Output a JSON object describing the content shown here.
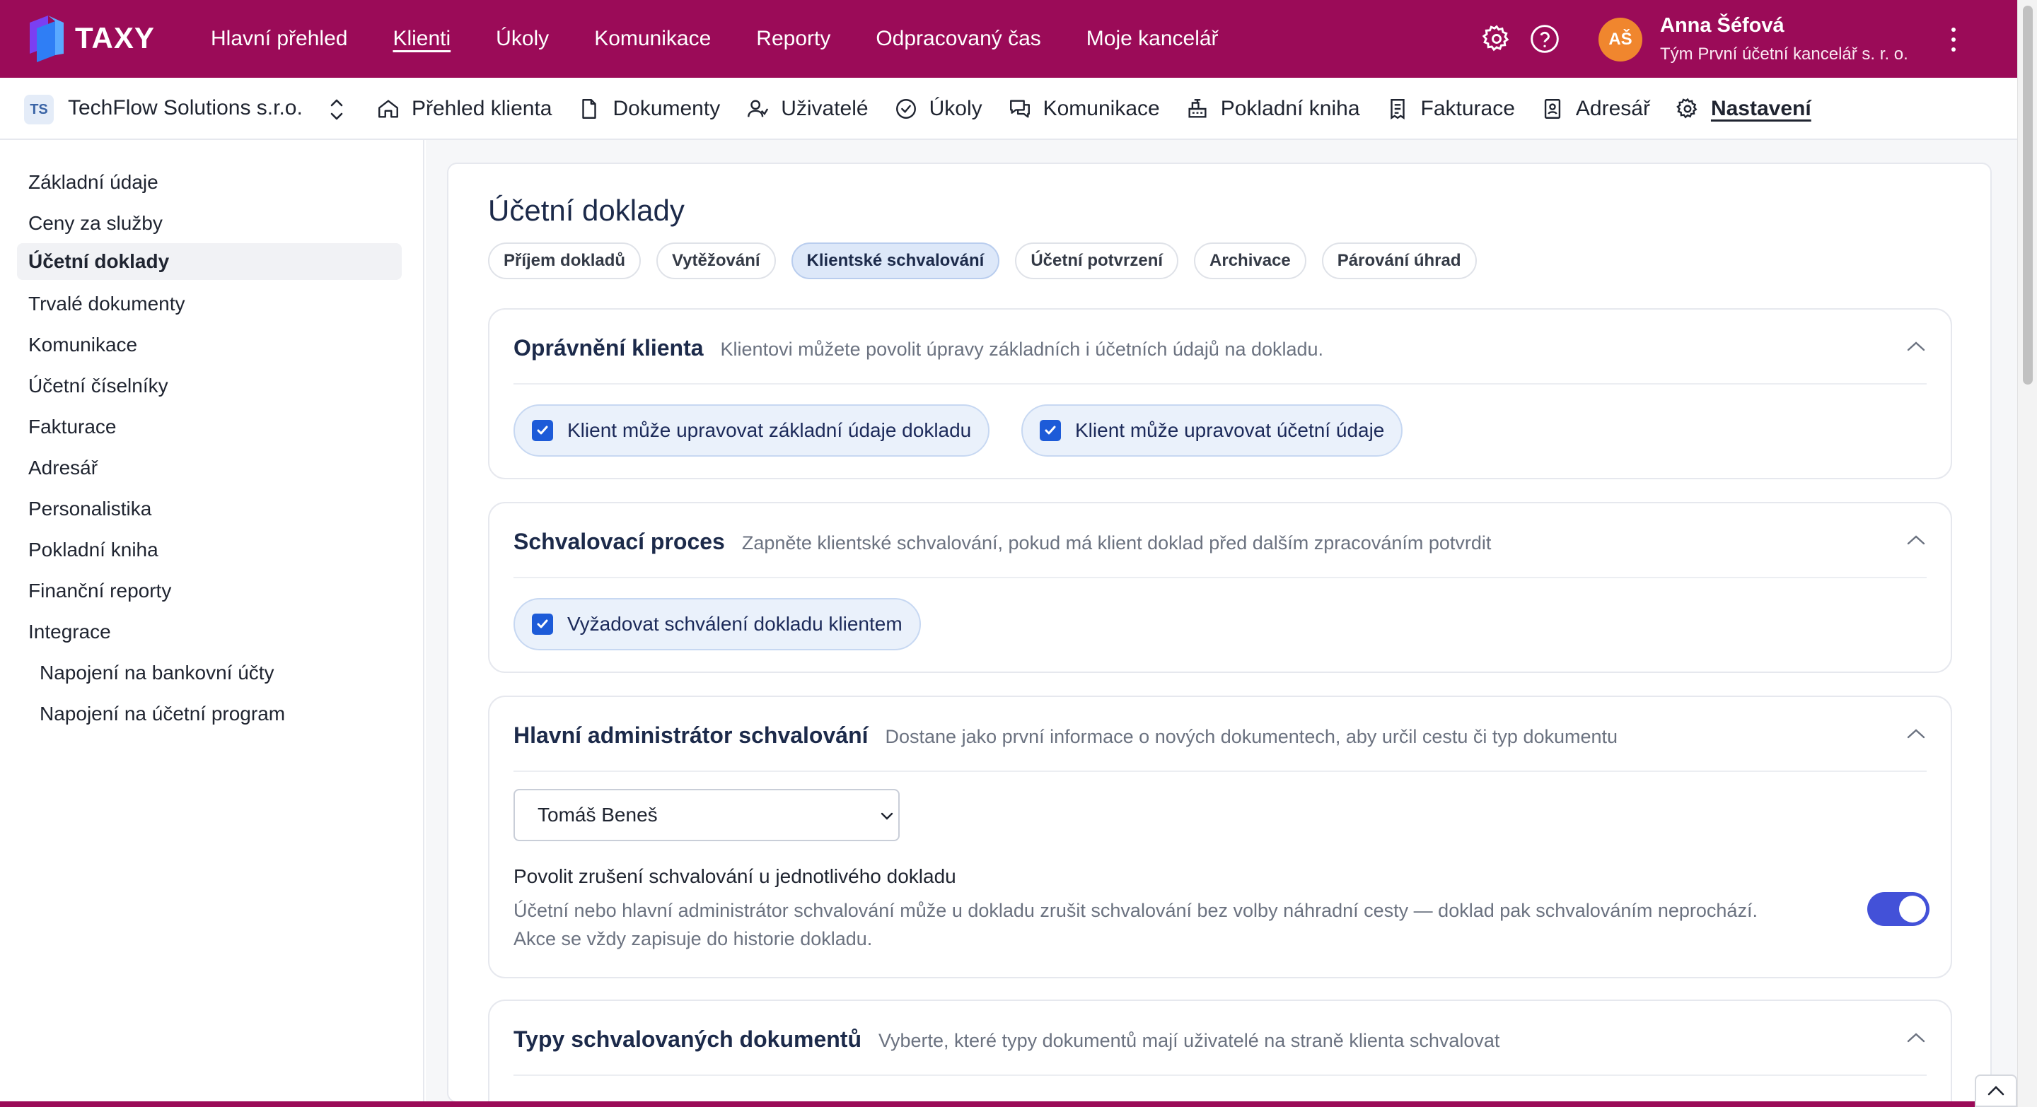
{
  "app": {
    "brand": "TAXY"
  },
  "top_nav": {
    "items": [
      "Hlavní přehled",
      "Klienti",
      "Úkoly",
      "Komunikace",
      "Reporty",
      "Odpracovaný čas",
      "Moje kancelář"
    ],
    "active": "Klienti"
  },
  "user": {
    "initials": "AŠ",
    "name": "Anna Šéfová",
    "team": "Tým První účetní kancelář s. r. o."
  },
  "client": {
    "badge": "TS",
    "name": "TechFlow Solutions s.r.o."
  },
  "sub_nav": {
    "items": [
      {
        "label": "Přehled klienta",
        "icon": "home-icon"
      },
      {
        "label": "Dokumenty",
        "icon": "document-icon"
      },
      {
        "label": "Uživatelé",
        "icon": "users-icon"
      },
      {
        "label": "Úkoly",
        "icon": "check-circle-icon"
      },
      {
        "label": "Komunikace",
        "icon": "chat-icon"
      },
      {
        "label": "Pokladní kniha",
        "icon": "cash-register-icon"
      },
      {
        "label": "Fakturace",
        "icon": "invoice-icon"
      },
      {
        "label": "Adresář",
        "icon": "contact-book-icon"
      },
      {
        "label": "Nastavení",
        "icon": "gear-icon"
      }
    ],
    "active": "Nastavení"
  },
  "sidebar": {
    "items": [
      "Základní údaje",
      "Ceny za služby",
      "Účetní doklady",
      "Trvalé dokumenty",
      "Komunikace",
      "Účetní číselníky",
      "Fakturace",
      "Adresář",
      "Personalistika",
      "Pokladní kniha",
      "Finanční reporty",
      "Integrace",
      "Napojení na bankovní účty",
      "Napojení na účetní program"
    ],
    "active": "Účetní doklady"
  },
  "page": {
    "title": "Účetní doklady",
    "tabs": [
      "Příjem dokladů",
      "Vytěžování",
      "Klientské schvalování",
      "Účetní potvrzení",
      "Archivace",
      "Párování úhrad"
    ],
    "active_tab": "Klientské schvalování"
  },
  "sections": {
    "permissions": {
      "title": "Oprávnění klienta",
      "desc": "Klientovi můžete povolit úpravy základních i účetních údajů na dokladu.",
      "options": [
        "Klient může upravovat základní údaje dokladu",
        "Klient může upravovat účetní údaje"
      ]
    },
    "process": {
      "title": "Schvalovací proces",
      "desc": "Zapněte klientské schvalování, pokud má klient doklad před dalším zpracováním potvrdit",
      "option": "Vyžadovat schválení dokladu klientem"
    },
    "admin": {
      "title": "Hlavní administrátor schvalování",
      "desc": "Dostane jako první informace o nových dokumentech, aby určil cestu či typ dokumentu",
      "selected": "Tomáš Beneš",
      "cancel_title": "Povolit zrušení schvalování u jednotlivého dokladu",
      "cancel_desc_1": "Účetní nebo hlavní administrátor schvalování může u dokladu zrušit schvalování bez volby náhradní cesty — doklad pak schvalováním neprochází.",
      "cancel_desc_2": "Akce se vždy zapisuje do historie dokladu.",
      "toggle_on": true
    },
    "types": {
      "title": "Typy schvalovaných dokumentů",
      "desc": "Vyberte, které typy dokumentů mají uživatelé na straně klienta schvalovat"
    }
  },
  "colors": {
    "brand": "#9b0b58",
    "accent": "#1d5bd8",
    "toggle": "#4351d8",
    "avatar": "#f0862e"
  }
}
